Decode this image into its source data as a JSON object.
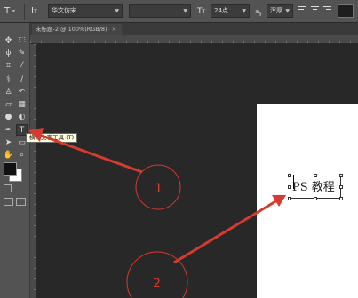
{
  "options_bar": {
    "tool_icon": "type-tool-icon",
    "orientation_icon": "text-orientation-icon",
    "font_family": "华文仿宋",
    "font_size_icon": "font-size-icon",
    "font_size": "24点",
    "aa_icon": "anti-alias-icon",
    "anti_alias": "浑厚",
    "text_color": "#1e1e1e"
  },
  "document_tab": {
    "title": "未标题-2 @ 100%(RGB/8)",
    "close": "×"
  },
  "tooltip": "横排文字工具 (T)",
  "canvas_text": "PS 教程",
  "annotations": {
    "circle1_label": "1",
    "circle2_label": "2",
    "color": "#d63b2f"
  },
  "toolbox": {
    "tools": [
      "move-tool-icon",
      "marquee-tool-icon",
      "lasso-tool-icon",
      "quick-select-tool-icon",
      "crop-tool-icon",
      "eyedropper-tool-icon",
      "healing-brush-icon",
      "brush-tool-icon",
      "clone-stamp-icon",
      "history-brush-icon",
      "eraser-tool-icon",
      "gradient-tool-icon",
      "blur-tool-icon",
      "dodge-tool-icon",
      "pen-tool-icon",
      "type-tool-icon",
      "path-select-tool-icon",
      "shape-tool-icon",
      "hand-tool-icon",
      "zoom-tool-icon"
    ],
    "foreground": "#111111",
    "background": "#ffffff"
  }
}
